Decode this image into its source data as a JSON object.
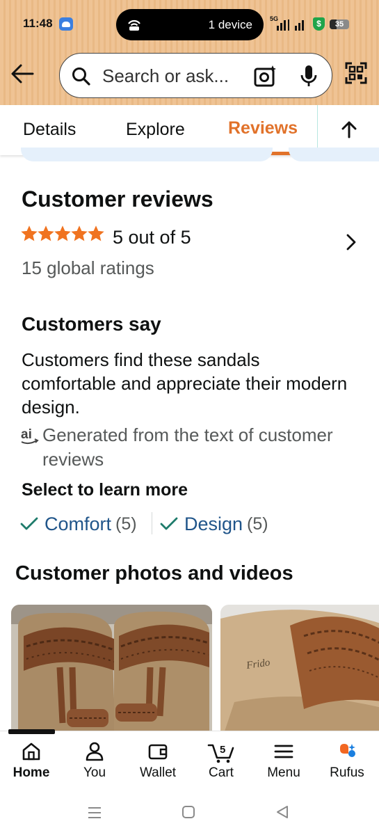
{
  "status_bar": {
    "time": "11:48",
    "hotspot_text": "1 device",
    "network": "5G",
    "battery": "35",
    "battery_level": 0.35
  },
  "search": {
    "placeholder": "Search or ask..."
  },
  "tabs": [
    {
      "label": "Details",
      "active": false
    },
    {
      "label": "Explore",
      "active": false
    },
    {
      "label": "Reviews",
      "active": true
    }
  ],
  "reviews": {
    "heading": "Customer reviews",
    "rating_value": 5,
    "rating_max": 5,
    "rating_text": "5 out of 5",
    "global_ratings": "15 global ratings",
    "star_color": "#f07320"
  },
  "customers_say": {
    "heading": "Customers say",
    "summary": "Customers find these sandals comfortable and appreciate their modern design.",
    "ai_note": "Generated from the text of customer reviews"
  },
  "learn_more": {
    "heading": "Select to learn more",
    "chips": [
      {
        "label": "Comfort",
        "count": "(5)"
      },
      {
        "label": "Design",
        "count": "(5)"
      }
    ]
  },
  "photos": {
    "heading": "Customer photos and videos",
    "photo_2_brand_text": "Frido"
  },
  "bottom_nav": {
    "home": "Home",
    "you": "You",
    "wallet": "Wallet",
    "cart": "Cart",
    "cart_count": "5",
    "menu": "Menu",
    "rufus": "Rufus"
  },
  "colors": {
    "accent_orange": "#e1722a",
    "link_blue": "#20558a",
    "check_green": "#1e7b6b"
  }
}
